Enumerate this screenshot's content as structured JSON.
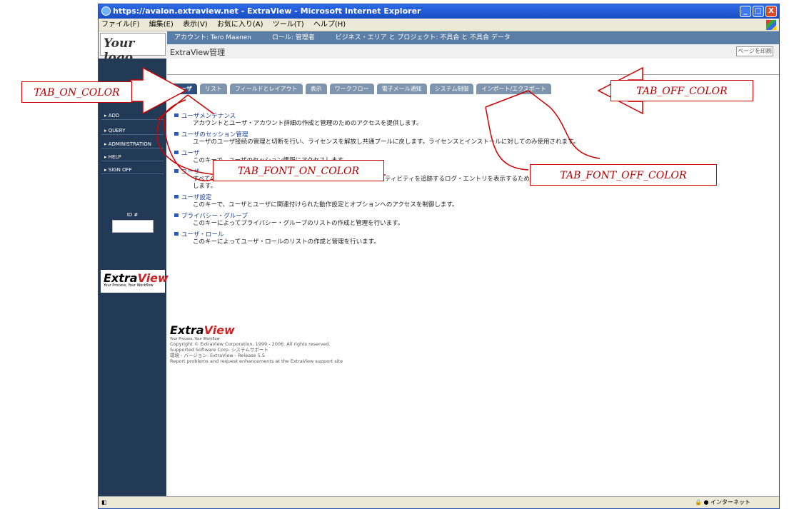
{
  "window": {
    "title": "https://avalon.extraview.net - ExtraView - Microsoft Internet Explorer",
    "controls": [
      "_",
      "□",
      "X"
    ]
  },
  "menu": [
    "ファイル(F)",
    "編集(E)",
    "表示(V)",
    "お気に入り(A)",
    "ツール(T)",
    "ヘルプ(H)"
  ],
  "header": {
    "logo_text": "Your logo",
    "nav": [
      "アカウント: Tero Maanen",
      "ロール: 管理者",
      "ビジネス・エリア と プロジェクト: 不具合 と 不具合 データ"
    ],
    "page_title": "ExtraView管理",
    "print_button": "ページを印刷"
  },
  "sidebar": {
    "items": [
      "ADD",
      "QUERY",
      "ADMINISTRATION",
      "HELP",
      "SIGN OFF"
    ],
    "id_label": "ID #",
    "brand": "ExtraView",
    "brand_tagline": "Your Process, Your Workflow"
  },
  "tabs": [
    "ユーザ",
    "リスト",
    "フィールドとレイアウト",
    "表示",
    "ワークフロー",
    "電子メール通知",
    "システム制御",
    "インポート/エクスポート"
  ],
  "content": [
    {
      "title": "ユーザメンテナンス",
      "desc": "アカウントとユーザ・アカウント詳細の作成と管理のためのアクセスを提供します。"
    },
    {
      "title": "ユーザのセッション管理",
      "desc": "ユーザのユーザ接続の管理と切断を行い、ライセンスを解放し共通プールに戻します。ライセンスとインストールに対してのみ使用されます。"
    },
    {
      "title": "ユーザ",
      "desc": "このキーで、ユーザのセッション情報にアクセスします。"
    },
    {
      "title": "ユーザ",
      "desc": "すべてのユーザのサインオン・アクティビティおよびサインオフ・アクティビティを追跡するログ・エントリを表示するためのアクセスを制御します。"
    },
    {
      "title": "ユーザ設定",
      "desc": "このキーで、ユーザとユーザに関連付けられた動作設定とオプションへのアクセスを制御します。"
    },
    {
      "title": "プライバシー・グループ",
      "desc": "このキーによってプライバシー・グループのリストの作成と管理を行います。"
    },
    {
      "title": "ユーザ・ロール",
      "desc": "このキーによってユーザ・ロールのリストの作成と管理を行います。"
    }
  ],
  "footer": {
    "brand": "ExtraView",
    "tagline": "Your Process, Your Workflow",
    "lines": [
      "Copyright © ExtraView Corporation, 1999 - 2006. All rights reserved.",
      "Supported Software Corp. システムサポート",
      "環境 - バージョン: ExtraView - Release 5.5",
      "Report problems and request enhancements at the ExtraView support site"
    ]
  },
  "statusbar": {
    "zone": "インターネット"
  },
  "annotations": {
    "tab_on_color": "TAB_ON_COLOR",
    "tab_off_color": "TAB_OFF_COLOR",
    "tab_font_on_color": "TAB_FONT_ON_COLOR",
    "tab_font_off_color": "TAB_FONT_OFF_COLOR",
    "arrow_color": "#cc0000"
  },
  "colors": {
    "tab_on": "#2d4e7a",
    "tab_off": "#7f95ad",
    "sidebar": "#223a56"
  }
}
